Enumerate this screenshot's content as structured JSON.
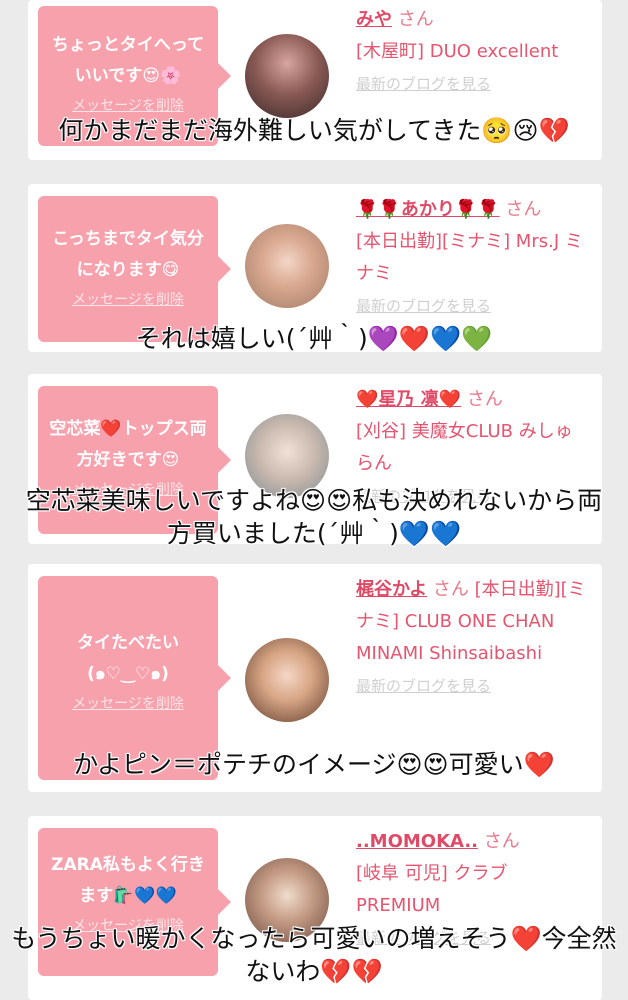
{
  "cards": [
    {
      "message": "ちょっとタイへっていいです😍🌸",
      "delete_label": "メッセージを削除",
      "name": "みや",
      "honorific": "さん",
      "shop": "[木屋町] DUO excellent",
      "blog_link": "最新のブログを見る",
      "comment": "何かまだまだ海外難しい気がしてきた🥺😢💔"
    },
    {
      "message": "こっちまでタイ気分になります😋",
      "delete_label": "メッセージを削除",
      "name": "🌹🌹あかり🌹🌹",
      "honorific": "さん",
      "shop": "[本日出勤][ミナミ] Mrs.J ミナミ",
      "blog_link": "最新のブログを見る",
      "comment": "それは嬉しい(´艸｀)💜❤️💙💚"
    },
    {
      "message": "空芯菜❤️トップス両方好きです😍",
      "delete_label": "メッセージを削除",
      "name": "❤️星乃 凛❤️",
      "honorific": "さん",
      "shop": "[刈谷] 美魔女CLUB みしゅらん",
      "blog_link": "最新のブログを見る",
      "comment": "空芯菜美味しいですよね😍😍私も決めれないから両方買いました(´艸｀)💙💙"
    },
    {
      "message": "タイたべたい(๑♡‿♡๑)",
      "delete_label": "メッセージを削除",
      "name": "梶谷かよ",
      "honorific": "さん",
      "shop": "[本日出勤][ミナミ] CLUB ONE CHAN MINAMI Shinsaibashi",
      "blog_link": "最新のブログを見る",
      "comment": "かよピン＝ポテチのイメージ😍😍可愛い❤️"
    },
    {
      "message": "ZARA私もよく行きます🛍️💙💙",
      "delete_label": "メッセージを削除",
      "name": "..MOMOKA..",
      "honorific": "さん",
      "shop": "[岐阜 可児] クラブ PREMIUM",
      "blog_link": "最新のブログを見る",
      "comment": "もうちょい暖かくなったら可愛いの増えそう❤️今全然ないわ💔💔"
    }
  ]
}
